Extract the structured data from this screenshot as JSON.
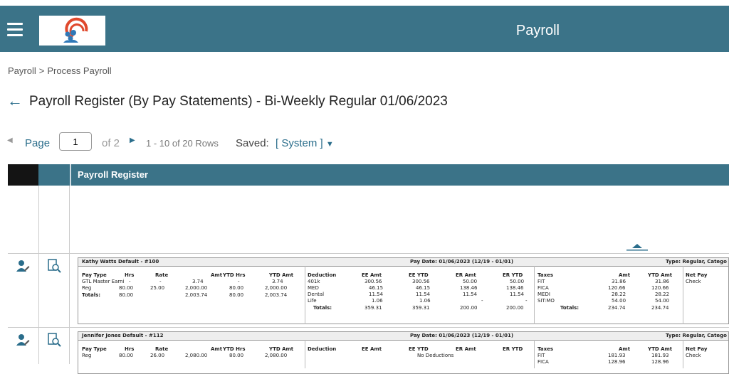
{
  "header": {
    "title": "Payroll",
    "logo": "company-logo",
    "menu_icon": "hamburger-icon"
  },
  "breadcrumb": {
    "root": "Payroll",
    "separator": ">",
    "current": "Process Payroll"
  },
  "page": {
    "back_icon": "arrow-left-icon",
    "title": "Payroll Register (By Pay Statements) - Bi-Weekly Regular 01/06/2023"
  },
  "pager": {
    "page_label": "Page",
    "page_value": "1",
    "of_text": "of 2",
    "rows_text": "1 - 10 of 20 Rows",
    "saved_label": "Saved:",
    "saved_value": "[ System ]"
  },
  "grid": {
    "column_title": "Payroll Register"
  },
  "statements": [
    {
      "employee": "Kathy Watts  Default - #100",
      "pay_date": "Pay Date: 01/06/2023 (12/19 - 01/01)",
      "type": "Type: Regular, Catego",
      "earn_headers": [
        "Pay Type",
        "Hrs",
        "Rate",
        "Amt",
        "YTD Hrs",
        "YTD Amt"
      ],
      "earnings": [
        [
          "GTL Master Earni",
          "-",
          "-",
          "3.74",
          "-",
          "3.74"
        ],
        [
          "Reg",
          "80.00",
          "25.00",
          "2,000.00",
          "80.00",
          "2,000.00"
        ],
        [
          "Totals:",
          "80.00",
          "",
          "2,003.74",
          "80.00",
          "2,003.74"
        ]
      ],
      "ded_headers": [
        "Deduction",
        "EE Amt",
        "EE YTD",
        "ER Amt",
        "ER YTD"
      ],
      "deductions": [
        [
          "401k",
          "300.56",
          "300.56",
          "50.00",
          "50.00"
        ],
        [
          "MED",
          "46.15",
          "46.15",
          "138.46",
          "138.46"
        ],
        [
          "Dental",
          "11.54",
          "11.54",
          "11.54",
          "11.54"
        ],
        [
          "Life",
          "1.06",
          "1.06",
          "-",
          "-"
        ],
        [
          "Totals:",
          "359.31",
          "359.31",
          "200.00",
          "200.00"
        ]
      ],
      "tax_headers": [
        "Taxes",
        "Amt",
        "YTD Amt"
      ],
      "taxes": [
        [
          "FIT",
          "31.86",
          "31.86"
        ],
        [
          "FICA",
          "120.66",
          "120.66"
        ],
        [
          "MEDI",
          "28.22",
          "28.22"
        ],
        [
          "SIT:MO",
          "54.00",
          "54.00"
        ],
        [
          "Totals:",
          "234.74",
          "234.74"
        ]
      ],
      "net_header": "Net Pay",
      "net_value": "Check"
    },
    {
      "employee": "Jennifer Jones  Default - #112",
      "pay_date": "Pay Date: 01/06/2023 (12/19 - 01/01)",
      "type": "Type: Regular, Catego",
      "earn_headers": [
        "Pay Type",
        "Hrs",
        "Rate",
        "Amt",
        "YTD Hrs",
        "YTD Amt"
      ],
      "earnings": [
        [
          "Reg",
          "80.00",
          "26.00",
          "2,080.00",
          "80.00",
          "2,080.00"
        ]
      ],
      "ded_headers": [
        "Deduction",
        "EE Amt",
        "EE YTD",
        "ER Amt",
        "ER YTD"
      ],
      "no_deductions": "No Deductions",
      "tax_headers": [
        "Taxes",
        "Amt",
        "YTD Amt"
      ],
      "taxes": [
        [
          "FIT",
          "181.93",
          "181.93"
        ],
        [
          "FICA",
          "128.96",
          "128.96"
        ]
      ],
      "net_header": "Net Pay",
      "net_value": "Check"
    }
  ],
  "row_icons": {
    "edit": "user-edit-icon",
    "view": "document-search-icon"
  },
  "colors": {
    "brand": "#3b7388",
    "link": "#2a6d8b"
  }
}
